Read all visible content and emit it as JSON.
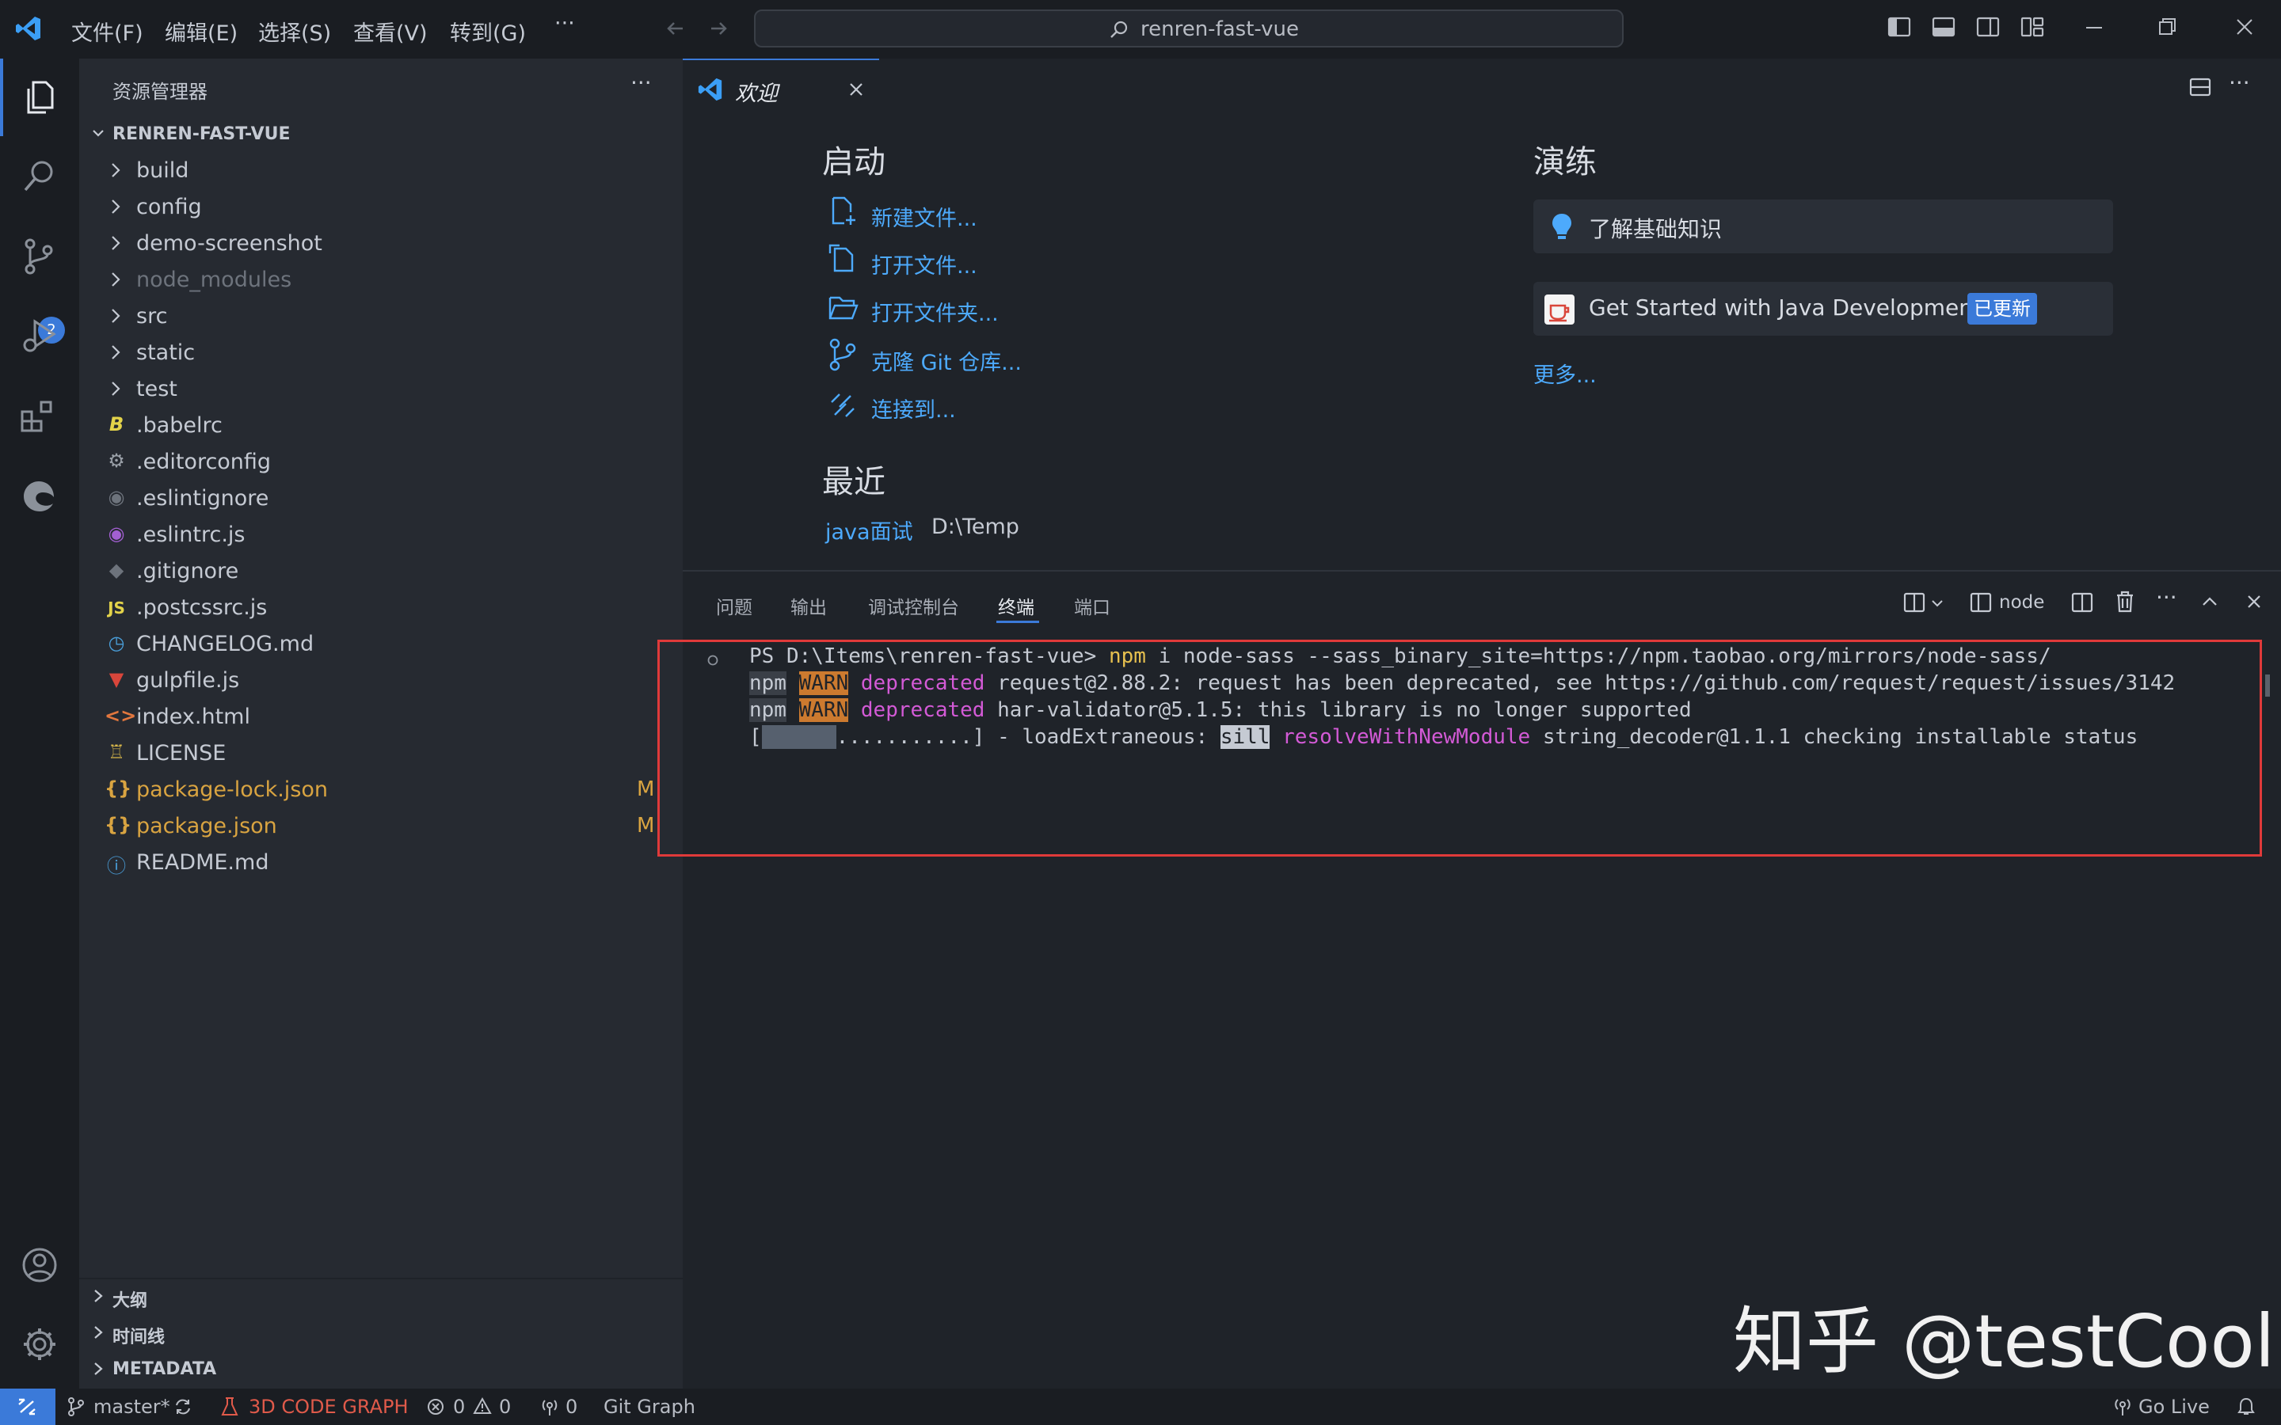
{
  "title_bar": {
    "menus": [
      "文件(F)",
      "编辑(E)",
      "选择(S)",
      "查看(V)",
      "转到(G)",
      "···"
    ],
    "search_text": "renren-fast-vue"
  },
  "activity_bar": {
    "source_control_badge": "2"
  },
  "sidebar": {
    "title": "资源管理器",
    "more": "···",
    "project": "RENREN-FAST-VUE",
    "items": [
      {
        "label": "build",
        "type": "folder"
      },
      {
        "label": "config",
        "type": "folder"
      },
      {
        "label": "demo-screenshot",
        "type": "folder"
      },
      {
        "label": "node_modules",
        "type": "folder"
      },
      {
        "label": "src",
        "type": "folder"
      },
      {
        "label": "static",
        "type": "folder"
      },
      {
        "label": "test",
        "type": "folder"
      },
      {
        "label": ".babelrc",
        "type": "file"
      },
      {
        "label": ".editorconfig",
        "type": "file"
      },
      {
        "label": ".eslintignore",
        "type": "file"
      },
      {
        "label": ".eslintrc.js",
        "type": "file"
      },
      {
        "label": ".gitignore",
        "type": "file"
      },
      {
        "label": ".postcssrc.js",
        "type": "file"
      },
      {
        "label": "CHANGELOG.md",
        "type": "file"
      },
      {
        "label": "gulpfile.js",
        "type": "file"
      },
      {
        "label": "index.html",
        "type": "file"
      },
      {
        "label": "LICENSE",
        "type": "file"
      },
      {
        "label": "package-lock.json",
        "type": "file",
        "modified": "M"
      },
      {
        "label": "package.json",
        "type": "file",
        "modified": "M"
      },
      {
        "label": "README.md",
        "type": "file"
      }
    ],
    "sections": [
      "大纲",
      "时间线",
      "METADATA"
    ]
  },
  "tab": {
    "label": "欢迎"
  },
  "welcome": {
    "start_heading": "启动",
    "start_links": [
      "新建文件...",
      "打开文件...",
      "打开文件夹...",
      "克隆 Git 仓库...",
      "连接到..."
    ],
    "recent_heading": "最近",
    "recent_name": "java面试",
    "recent_path": "D:\\Temp",
    "walk_heading": "演练",
    "walk_items": [
      "了解基础知识",
      "Get Started with Java Development"
    ],
    "updated_badge": "已更新",
    "more": "更多..."
  },
  "panel": {
    "tabs": [
      "问题",
      "输出",
      "调试控制台",
      "终端",
      "端口"
    ],
    "node_label": "node",
    "terminal": {
      "prompt": "PS D:\\Items\\renren-fast-vue> ",
      "cmd": "npm",
      "cmd_rest": " i node-sass --sass_binary_site=https://npm.taobao.org/mirrors/node-sass/",
      "npm": "npm",
      "warn": "WARN",
      "deprecated": "deprecated",
      "line2_rest": " request@2.88.2: request has been deprecated, see https://github.com/request/request/issues/3142",
      "line3_rest": " har-validator@5.1.5: this library is no longer supported",
      "progress_open": "[",
      "progress_fill": "      ",
      "progress_rest": "...........] - loadExtraneous: ",
      "sill": "sill",
      "resolve": "resolveWithNewModule",
      "line4_rest": " string_decoder@1.1.1 checking installable status"
    }
  },
  "status_bar": {
    "branch": "master*",
    "code_graph": "3D CODE GRAPH",
    "errors": "0",
    "warnings": "0",
    "ports": "0",
    "git_graph": "Git Graph",
    "go_live": "Go Live"
  },
  "watermark": "知乎 @testCool",
  "colors": {
    "accent": "#3b7ad9",
    "link": "#4daafc",
    "modified": "#d9a441",
    "highlight_frame": "#e03a3a"
  }
}
